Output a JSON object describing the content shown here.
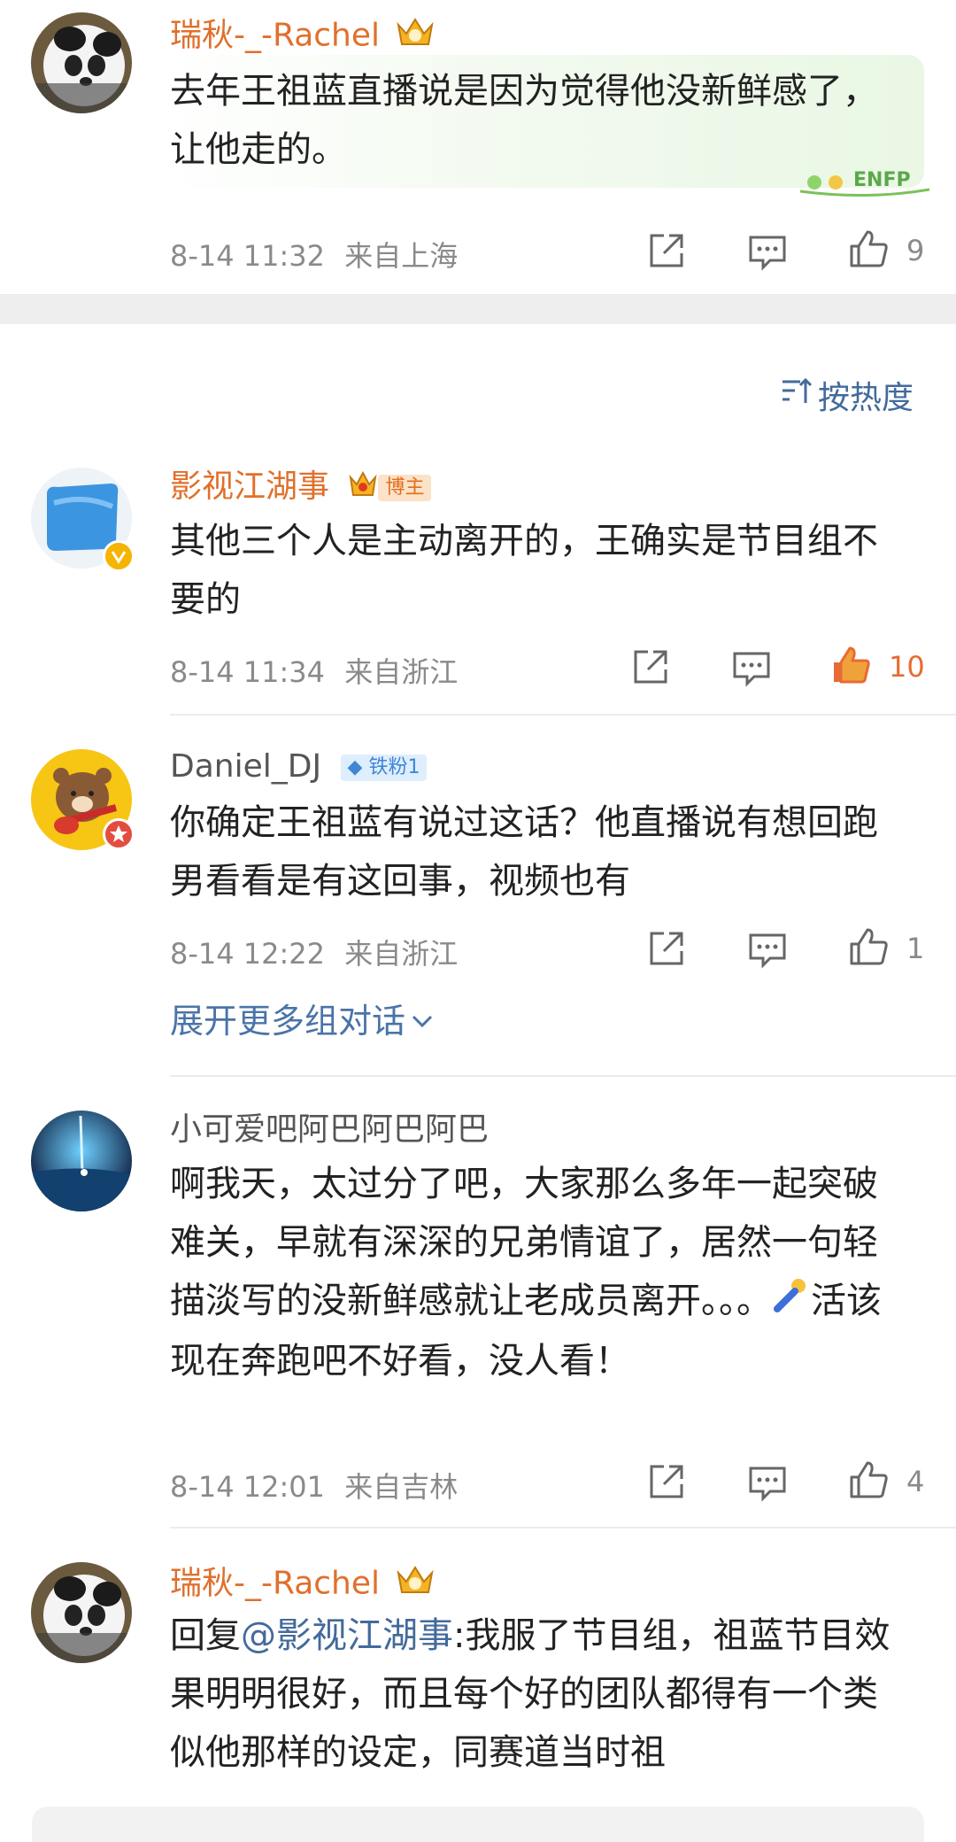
{
  "comments": [
    {
      "user": "瑞秋-_-Rachel",
      "text": "去年王祖蓝直播说是因为觉得他没新鲜感了，让他走的。",
      "time": "8-14 11:32",
      "location": "来自上海",
      "likes": "9",
      "decor_text": "ENFP"
    },
    {
      "user": "影视江湖事",
      "tag": "博主",
      "text": "其他三个人是主动离开的，王确实是节目组不要的",
      "time": "8-14 11:34",
      "location": "来自浙江",
      "likes": "10"
    },
    {
      "user": "Daniel_DJ",
      "tag": "铁粉1",
      "text": "你确定王祖蓝有说过这话？他直播说有想回跑男看看是有这回事，视频也有",
      "time": "8-14 12:22",
      "location": "来自浙江",
      "likes": "1"
    },
    {
      "user": "小可爱吧阿巴阿巴阿巴",
      "text_a": "啊我天，太过分了吧，大家那么多年一起突破难关，早就有深深的兄弟情谊了，居然一句轻描淡写的没新鲜感就让老成员离开。。。",
      "text_b": "活该现在奔跑吧不好看，没人看！",
      "time": "8-14 12:01",
      "location": "来自吉林",
      "likes": "4"
    },
    {
      "user": "瑞秋-_-Rachel",
      "reply_prefix": "回复",
      "mention": "@影视江湖事",
      "text": ":我服了节目组，祖蓝节目效果明明很好，而且每个好的团队都得有一个类似他那样的设定，同赛道当时祖"
    }
  ],
  "sort_label": "按热度",
  "expand_label": "展开更多组对话",
  "colors": {
    "link": "#436a9b",
    "username": "#e0702c",
    "meta": "#8a8a8a",
    "like_active": "#e76b34"
  }
}
